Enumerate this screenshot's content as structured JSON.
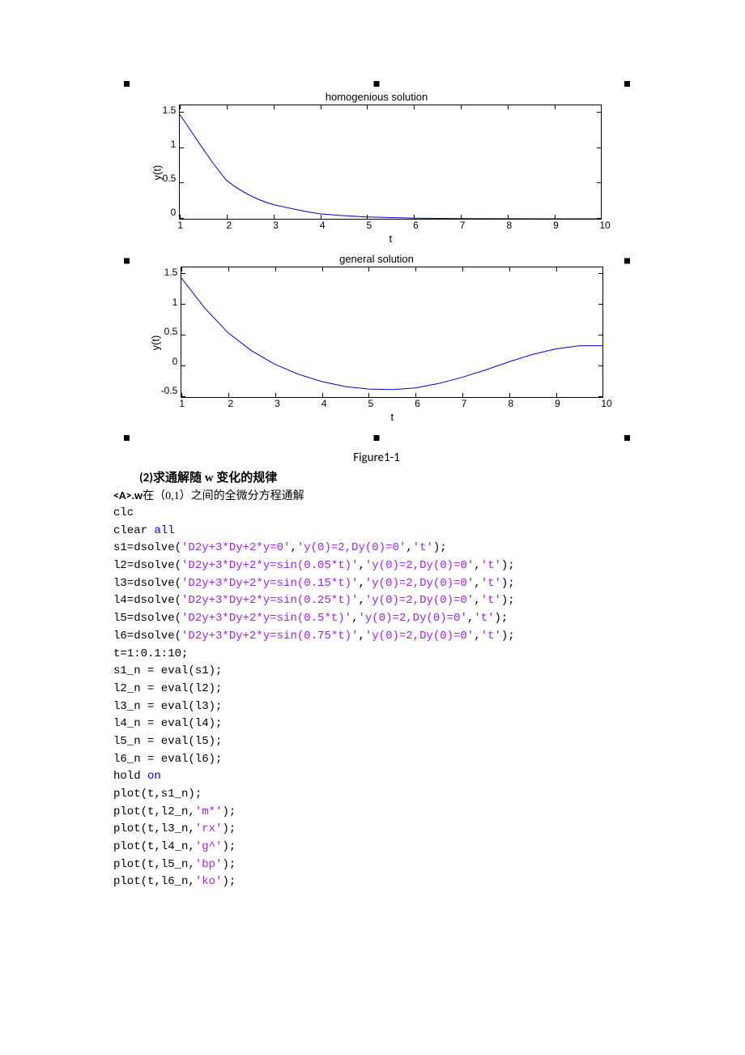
{
  "figure_caption": "Figure1-1",
  "heading2": {
    "num": "(2)",
    "text_bold": "求通解随 w 变化的规律"
  },
  "subheading": {
    "tag": "<A>.w",
    "rest": "在（0,1）之间的全微分方程通解"
  },
  "chart_data": [
    {
      "type": "line",
      "title": "homogenious solution",
      "xlabel": "t",
      "ylabel": "y(t)",
      "xlim": [
        1,
        10
      ],
      "ylim": [
        0,
        1.6
      ],
      "xticks": [
        1,
        2,
        3,
        4,
        5,
        6,
        7,
        8,
        9,
        10
      ],
      "yticks": [
        0,
        0.5,
        1,
        1.5
      ],
      "x": [
        1,
        2,
        3,
        4,
        5,
        6,
        7,
        8,
        9,
        10
      ],
      "values": [
        1.47,
        0.54,
        0.2,
        0.07,
        0.03,
        0.01,
        0.004,
        0.001,
        0.0005,
        0.0002
      ]
    },
    {
      "type": "line",
      "title": "general solution",
      "xlabel": "t",
      "ylabel": "y(t)",
      "xlim": [
        1,
        10
      ],
      "ylim": [
        -0.5,
        1.6
      ],
      "xticks": [
        1,
        2,
        3,
        4,
        5,
        6,
        7,
        8,
        9,
        10
      ],
      "yticks": [
        -0.5,
        0,
        0.5,
        1,
        1.5
      ],
      "x": [
        1,
        1.5,
        2,
        2.5,
        3,
        3.5,
        4,
        4.5,
        5,
        5.5,
        6,
        6.5,
        7,
        7.5,
        8,
        8.5,
        9,
        9.5,
        10
      ],
      "values": [
        1.43,
        0.94,
        0.54,
        0.25,
        0.03,
        -0.13,
        -0.25,
        -0.33,
        -0.37,
        -0.38,
        -0.35,
        -0.28,
        -0.18,
        -0.06,
        0.07,
        0.19,
        0.28,
        0.33,
        0.33
      ]
    }
  ],
  "code": {
    "l01": "clc",
    "l02a": "clear ",
    "l02b": "all",
    "l03a": "s1=dsolve(",
    "l03b": "'D2y+3*Dy+2*y=0'",
    "l03c": ",",
    "l03d": "'y(0)=2,Dy(0)=0'",
    "l03e": ",",
    "l03f": "'t'",
    "l03g": ");",
    "l04a": "l2=dsolve(",
    "l04b": "'D2y+3*Dy+2*y=sin(0.05*t)'",
    "l04c": ",",
    "l04d": "'y(0)=2,Dy(0)=0'",
    "l04e": ",",
    "l04f": "'t'",
    "l04g": ");",
    "l05a": "l3=dsolve(",
    "l05b": "'D2y+3*Dy+2*y=sin(0.15*t)'",
    "l05c": ",",
    "l05d": "'y(0)=2,Dy(0)=0'",
    "l05e": ",",
    "l05f": "'t'",
    "l05g": ");",
    "l06a": "l4=dsolve(",
    "l06b": "'D2y+3*Dy+2*y=sin(0.25*t)'",
    "l06c": ",",
    "l06d": "'y(0)=2,Dy(0)=0'",
    "l06e": ",",
    "l06f": "'t'",
    "l06g": ");",
    "l07a": "l5=dsolve(",
    "l07b": "'D2y+3*Dy+2*y=sin(0.5*t)'",
    "l07c": ",",
    "l07d": "'y(0)=2,Dy(0)=0'",
    "l07e": ",",
    "l07f": "'t'",
    "l07g": ");",
    "l08a": "l6=dsolve(",
    "l08b": "'D2y+3*Dy+2*y=sin(0.75*t)'",
    "l08c": ",",
    "l08d": "'y(0)=2,Dy(0)=0'",
    "l08e": ",",
    "l08f": "'t'",
    "l08g": ");",
    "l09": "t=1:0.1:10;",
    "l10": "s1_n = eval(s1);",
    "l11": "l2_n = eval(l2);",
    "l12": "l3_n = eval(l3);",
    "l13": "l4_n = eval(l4);",
    "l14": "l5_n = eval(l5);",
    "l15": "l6_n = eval(l6);",
    "l16a": "hold ",
    "l16b": "on",
    "l17": "plot(t,s1_n);",
    "l18a": "plot(t,l2_n,",
    "l18b": "'m*'",
    "l18c": ");",
    "l19a": "plot(t,l3_n,",
    "l19b": "'rx'",
    "l19c": ");",
    "l20a": "plot(t,l4_n,",
    "l20b": "'g^'",
    "l20c": ");",
    "l21a": "plot(t,l5_n,",
    "l21b": "'bp'",
    "l21c": ");",
    "l22a": "plot(t,l6_n,",
    "l22b": "'ko'",
    "l22c": ");"
  }
}
